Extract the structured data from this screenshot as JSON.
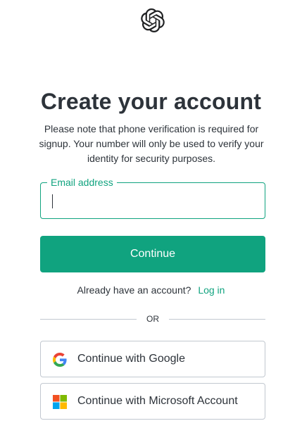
{
  "header": {
    "logo_icon": "openai-logo-icon"
  },
  "main": {
    "title": "Create your account",
    "note": "Please note that phone verification is required for signup. Your number will only be used to verify your identity for security purposes.",
    "email_label": "Email address",
    "email_value": "",
    "continue_label": "Continue",
    "login_prompt": "Already have an account?",
    "login_link": "Log in",
    "divider_text": "OR",
    "google_label": "Continue with Google",
    "microsoft_label": "Continue with Microsoft Account"
  },
  "colors": {
    "accent": "#10a37f",
    "text": "#2d333a",
    "border": "#c2c8d0"
  }
}
